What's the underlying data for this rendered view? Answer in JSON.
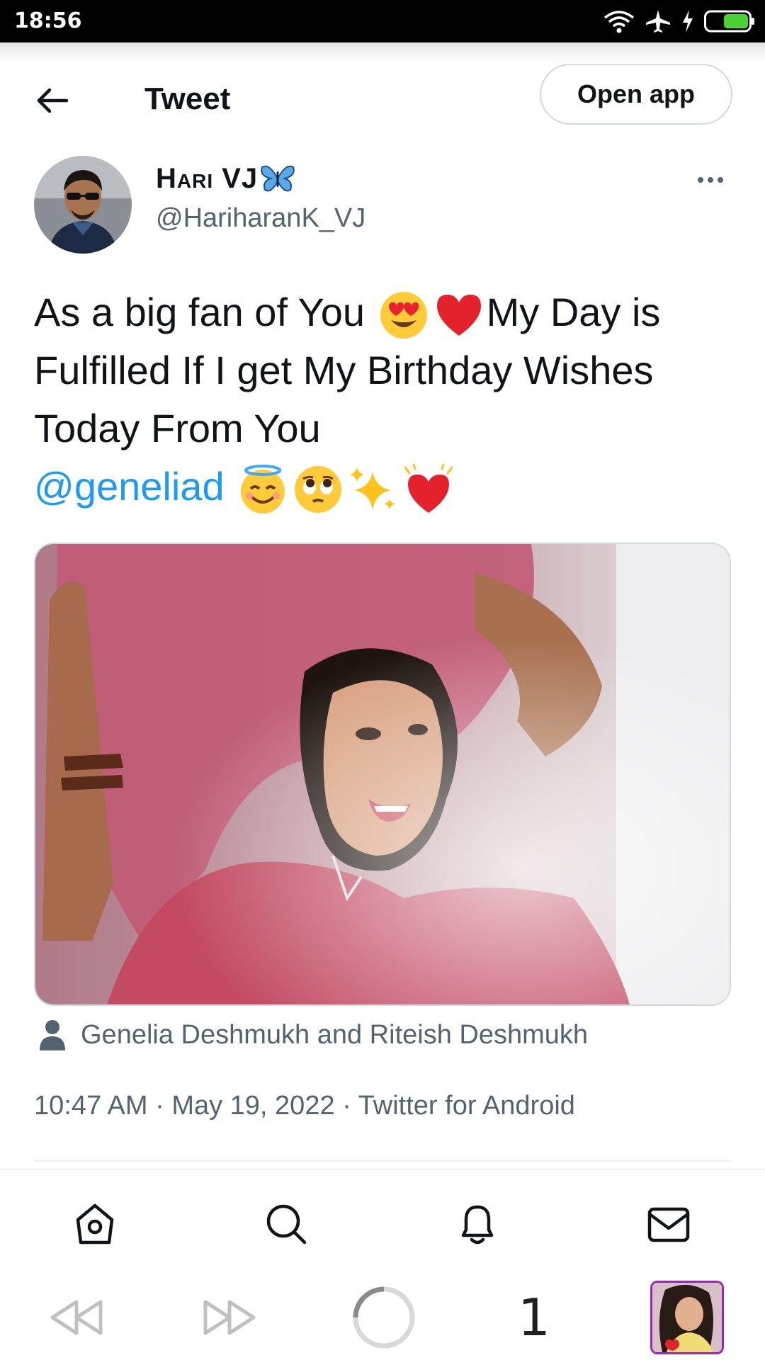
{
  "status_bar": {
    "time": "18:56"
  },
  "header": {
    "title": "Tweet",
    "open_app_label": "Open app"
  },
  "tweet": {
    "author_name": "Hari VJ",
    "author_handle": "@HariharanK_VJ",
    "text_1": "As a big fan of You ",
    "text_2": "My Day is Fulfilled If I get My Birthday Wishes Today From You",
    "mention": "@geneliad",
    "media_tags": "Genelia Deshmukh and Riteish Deshmukh",
    "meta": "10:47 AM · May 19, 2022 · Twitter for Android"
  },
  "browser_bar": {
    "tab_count": "1"
  },
  "icons": [
    "wifi-icon",
    "airplane-icon",
    "charging-icon",
    "battery-icon",
    "back-arrow-icon",
    "more-icon",
    "butterfly-icon",
    "heart-eyes-emoji",
    "red-heart-emoji",
    "halo-emoji",
    "pleading-emoji",
    "sparkles-emoji",
    "heart-ribbon-emoji",
    "person-icon",
    "home-icon",
    "search-icon",
    "bell-icon",
    "mail-icon",
    "rewind-icon",
    "fast-forward-icon",
    "loading-icon"
  ],
  "colors": {
    "accent": "#1d9bf0",
    "secondary_text": "#536471",
    "primary_text": "#0f1419",
    "battery": "#4cd137"
  }
}
